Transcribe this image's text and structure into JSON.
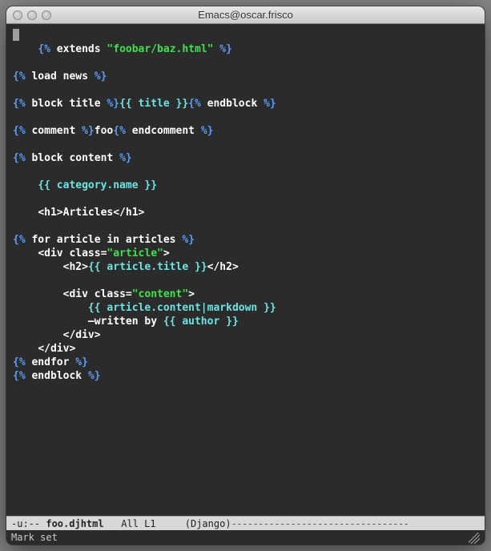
{
  "titlebar": {
    "title": "Emacs@oscar.frisco"
  },
  "code": {
    "l1": {
      "o1": "{%",
      "kw": " extends ",
      "str": "\"foobar/baz.html\"",
      "o2": " %}"
    },
    "l3": {
      "o1": "{%",
      "kw": " load news ",
      "o2": "%}"
    },
    "l5": {
      "o1": "{%",
      "kw": " block title ",
      "o2": "%}",
      "v1": "{{",
      "v2": " title ",
      "v3": "}}",
      "o3": "{%",
      "kw2": " endblock ",
      "o4": "%}"
    },
    "l7": {
      "o1": "{%",
      "kw": " comment ",
      "o2": "%}",
      "txt": "foo",
      "o3": "{%",
      "kw2": " endcomment ",
      "o4": "%}"
    },
    "l9": {
      "o1": "{%",
      "kw": " block content ",
      "o2": "%}"
    },
    "l11": {
      "ind": "    ",
      "v1": "{{",
      "v2": " category.name ",
      "v3": "}}"
    },
    "l13": {
      "ind": "    ",
      "txt": "<h1>Articles</h1>"
    },
    "l15": {
      "o1": "{%",
      "kw": " for article in articles ",
      "o2": "%}"
    },
    "l16": {
      "ind": "    ",
      "t1": "<div class=",
      "str": "\"article\"",
      "t2": ">"
    },
    "l17": {
      "ind": "        ",
      "t1": "<h2>",
      "v1": "{{",
      "v2": " article.title ",
      "v3": "}}",
      "t2": "</h2>"
    },
    "l19": {
      "ind": "        ",
      "t1": "<div class=",
      "str": "\"content\"",
      "t2": ">"
    },
    "l20": {
      "ind": "            ",
      "v1": "{{",
      "v2": " article.content|markdown ",
      "v3": "}}"
    },
    "l21": {
      "ind": "            ",
      "t1": "—written by ",
      "v1": "{{",
      "v2": " author ",
      "v3": "}}"
    },
    "l22": {
      "ind": "        ",
      "t1": "</div>"
    },
    "l23": {
      "ind": "    ",
      "t1": "</div>"
    },
    "l24": {
      "o1": "{%",
      "kw": " endfor ",
      "o2": "%}"
    },
    "l25": {
      "o1": "{%",
      "kw": " endblock ",
      "o2": "%}"
    }
  },
  "modeline": {
    "left": "-u:-- ",
    "buffer": "foo.djhtml",
    "pos": "   All L1 ",
    "mode": "    (Django)",
    "dashes": "---------------------------------"
  },
  "minibuffer": {
    "msg": "Mark set"
  }
}
